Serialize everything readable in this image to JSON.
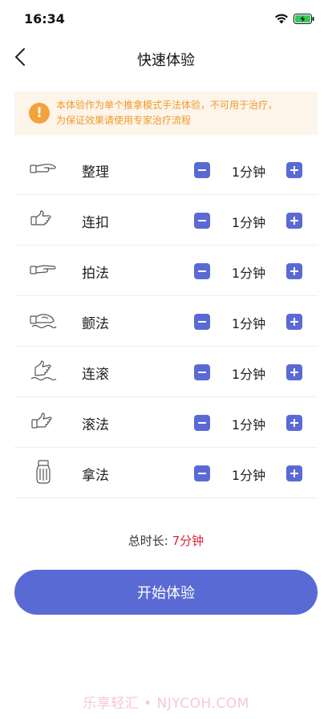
{
  "status": {
    "time": "16:34"
  },
  "nav": {
    "title": "快速体验"
  },
  "notice": {
    "line1": "本体验作为单个推拿模式手法体验，不可用于治疗，",
    "line2": "为保证效果请使用专家治疗流程"
  },
  "items": [
    {
      "name": "整理",
      "value": "1分钟",
      "icon": "hand-flat-icon"
    },
    {
      "name": "连扣",
      "value": "1分钟",
      "icon": "hand-tap-icon"
    },
    {
      "name": "拍法",
      "value": "1分钟",
      "icon": "hand-pat-icon"
    },
    {
      "name": "颤法",
      "value": "1分钟",
      "icon": "hand-vibrate-icon"
    },
    {
      "name": "连滚",
      "value": "1分钟",
      "icon": "hand-roll-continuous-icon"
    },
    {
      "name": "滚法",
      "value": "1分钟",
      "icon": "hand-roll-icon"
    },
    {
      "name": "拿法",
      "value": "1分钟",
      "icon": "hand-grasp-icon"
    }
  ],
  "total": {
    "label": "总时长:",
    "value": "7分钟"
  },
  "start_button": {
    "label": "开始体验"
  },
  "watermark": "乐享轻汇 • NJYCOH.COM",
  "colors": {
    "accent": "#5a6ad4",
    "warning": "#f3a23c",
    "total_value": "#e0223a"
  }
}
